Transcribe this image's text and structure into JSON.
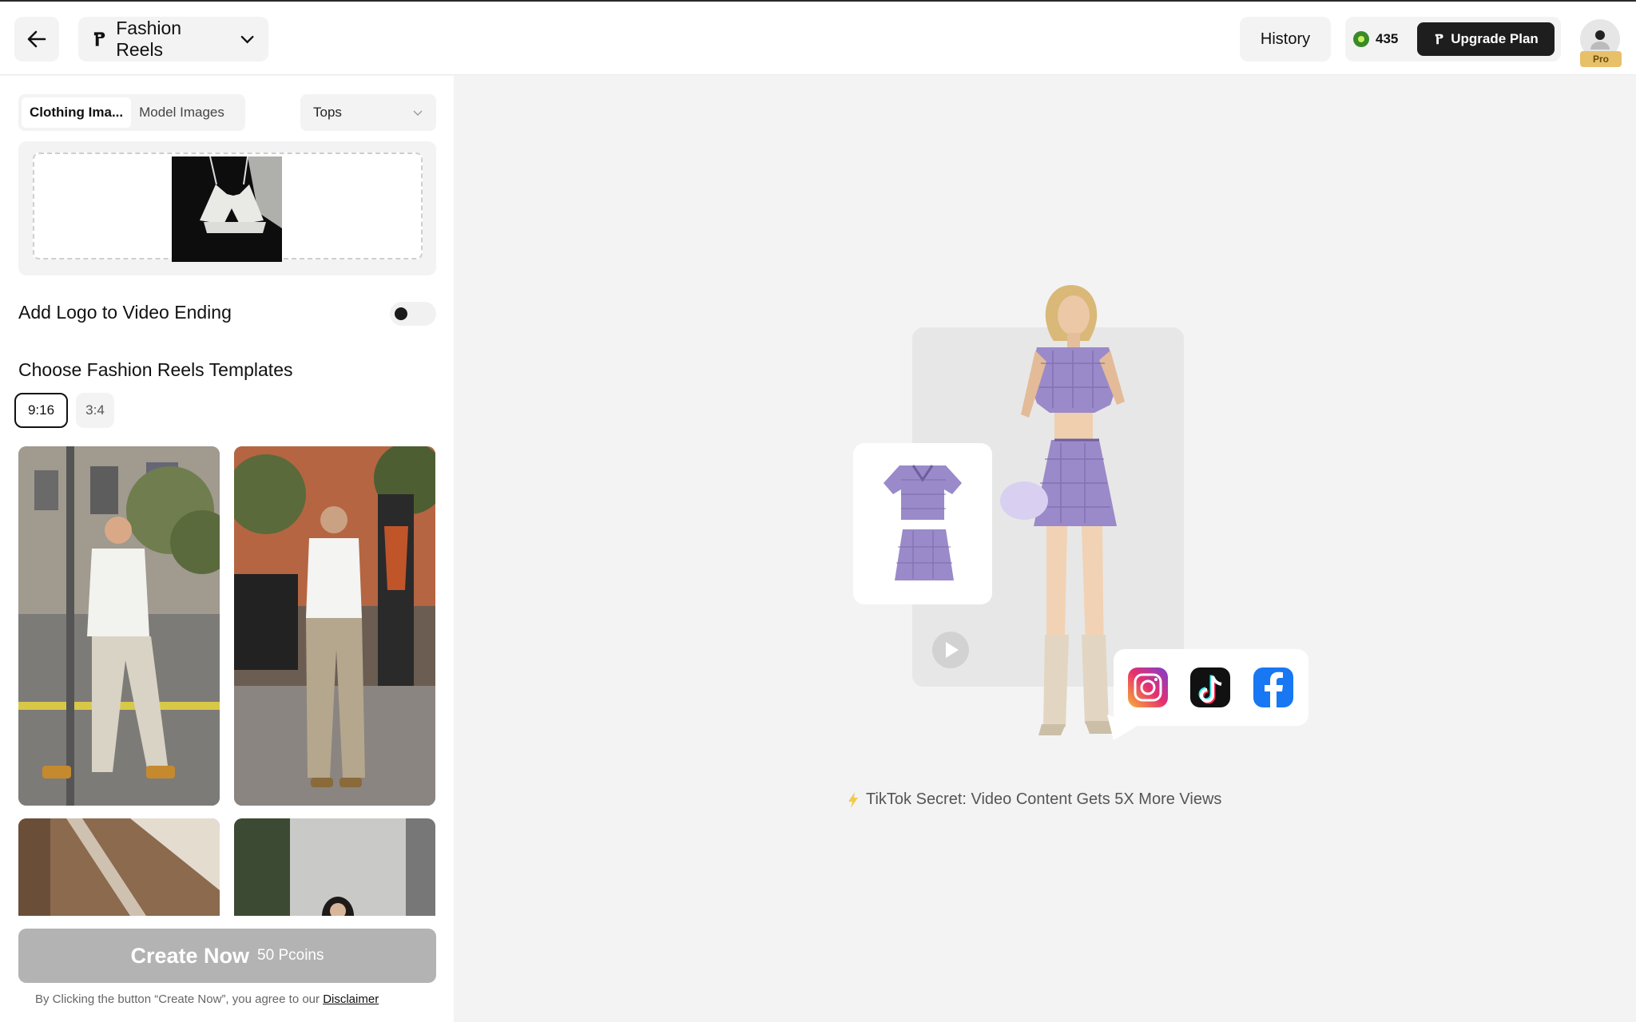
{
  "header": {
    "app_title": "Fashion Reels",
    "history_label": "History",
    "credits": "435",
    "upgrade_label": "Upgrade Plan",
    "avatar_badge": "Pro"
  },
  "left_panel": {
    "tabs": [
      {
        "label": "Clothing Ima...",
        "active": true
      },
      {
        "label": "Model Images",
        "active": false
      }
    ],
    "category_select": "Tops",
    "logo_toggle_label": "Add Logo to Video Ending",
    "logo_toggle_on": false,
    "templates_heading": "Choose Fashion Reels Templates",
    "ratios": [
      {
        "label": "9:16",
        "active": true
      },
      {
        "label": "3:4",
        "active": false
      }
    ],
    "create_label": "Create Now",
    "create_cost": "50 Pcoins",
    "disclaimer_text": "By Clicking the button “Create Now”, you agree to our",
    "disclaimer_link": "Disclaimer"
  },
  "preview": {
    "tip_text": "TikTok Secret: Video Content Gets 5X More Views",
    "social_icons": [
      "instagram-icon",
      "tiktok-icon",
      "facebook-icon"
    ]
  },
  "colors": {
    "accent_dark": "#1e1e1e",
    "pro_badge": "#e8c06a",
    "disabled_button": "#b3b3b3",
    "coin": "#3a8a2a",
    "plaid": "#9a8ac9"
  }
}
